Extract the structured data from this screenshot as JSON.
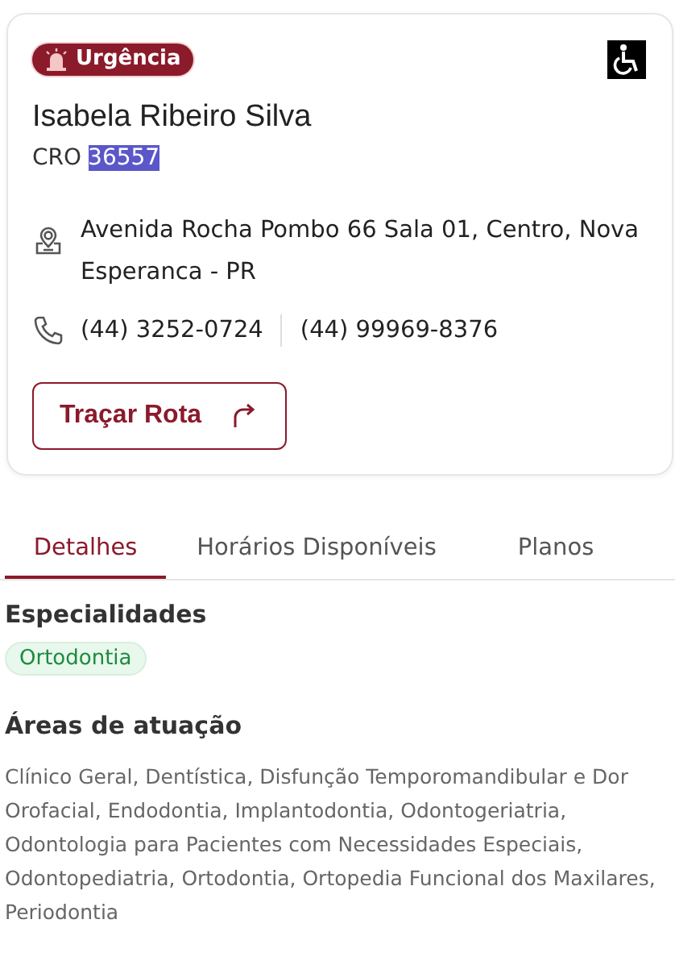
{
  "card": {
    "badge": {
      "label": "Urgência"
    },
    "accessible": true,
    "name": "Isabela Ribeiro Silva",
    "cro": {
      "label": "CRO",
      "number": "36557",
      "highlighted": true
    },
    "address": "Avenida Rocha Pombo 66 Sala 01, Centro, Nova Esperanca - PR",
    "phones": [
      "(44) 3252-0724",
      "(44) 99969-8376"
    ],
    "route_button": "Traçar Rota"
  },
  "tabs": [
    {
      "label": "Detalhes",
      "selected": true
    },
    {
      "label": "Horários Disponíveis",
      "selected": false
    },
    {
      "label": "Planos",
      "selected": false
    }
  ],
  "specialties": {
    "title": "Especialidades",
    "tags": [
      "Ortodontia"
    ]
  },
  "areas": {
    "title": "Áreas de atuação",
    "text": "Clínico Geral, Dentística, Disfunção Temporomandibular e Dor Orofacial, Endodontia, Implantodontia, Odontogeriatria, Odontologia para Pacientes com Necessidades Especiais, Odontopediatria, Ortodontia, Ortopedia Funcional dos Maxilares, Periodontia"
  }
}
